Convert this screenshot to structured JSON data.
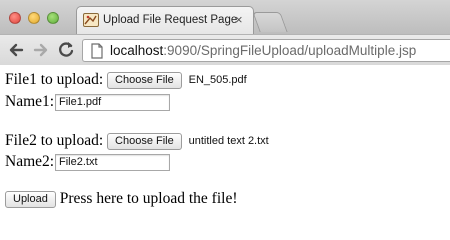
{
  "browser": {
    "tab_title": "Upload File Request Page",
    "tab_close": "×",
    "url_host": "localhost",
    "url_rest": ":9090/SpringFileUpload/uploadMultiple.jsp"
  },
  "form": {
    "file1_label": "File1 to upload:",
    "file1_button": "Choose File",
    "file1_chosen": "EN_505.pdf",
    "name1_label": "Name1:",
    "name1_value": "File1.pdf",
    "file2_label": "File2 to upload:",
    "file2_button": "Choose File",
    "file2_chosen": "untitled text 2.txt",
    "name2_label": "Name2:",
    "name2_value": "File2.txt",
    "upload_button": "Upload",
    "upload_hint": "Press here to upload the file!"
  },
  "icons": {
    "back": "arrow-left",
    "forward": "arrow-right",
    "reload": "reload",
    "page": "document"
  }
}
